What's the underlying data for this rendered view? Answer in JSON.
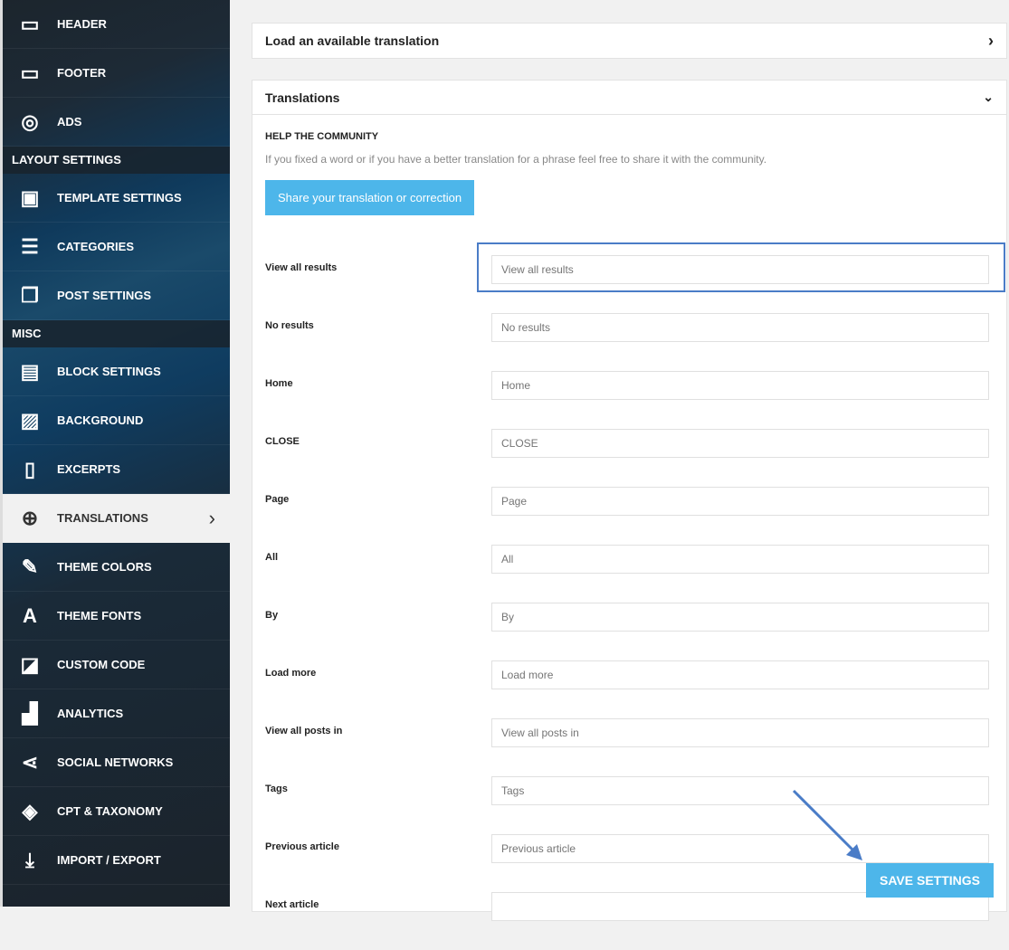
{
  "sidebar": {
    "items": [
      {
        "label": "HEADER",
        "icon": "header-icon",
        "glyph": "▭"
      },
      {
        "label": "FOOTER",
        "icon": "footer-icon",
        "glyph": "▭"
      },
      {
        "label": "ADS",
        "icon": "target-icon",
        "glyph": "◎"
      }
    ],
    "section_layout": "LAYOUT SETTINGS",
    "layout_items": [
      {
        "label": "TEMPLATE SETTINGS",
        "icon": "template-icon",
        "glyph": "▣"
      },
      {
        "label": "CATEGORIES",
        "icon": "list-icon",
        "glyph": "☰"
      },
      {
        "label": "POST SETTINGS",
        "icon": "post-icon",
        "glyph": "❐"
      }
    ],
    "section_misc": "MISC",
    "misc_items": [
      {
        "label": "BLOCK SETTINGS",
        "icon": "block-icon",
        "glyph": "▤"
      },
      {
        "label": "BACKGROUND",
        "icon": "image-icon",
        "glyph": "▨"
      },
      {
        "label": "EXCERPTS",
        "icon": "document-icon",
        "glyph": "▯"
      },
      {
        "label": "TRANSLATIONS",
        "icon": "globe-icon",
        "glyph": "⊕"
      },
      {
        "label": "THEME COLORS",
        "icon": "brush-icon",
        "glyph": "✎"
      },
      {
        "label": "THEME FONTS",
        "icon": "font-icon",
        "glyph": "A"
      },
      {
        "label": "CUSTOM CODE",
        "icon": "code-icon",
        "glyph": "◪"
      },
      {
        "label": "ANALYTICS",
        "icon": "chart-icon",
        "glyph": "▟"
      },
      {
        "label": "SOCIAL NETWORKS",
        "icon": "share-icon",
        "glyph": "⋖"
      },
      {
        "label": "CPT & TAXONOMY",
        "icon": "cube-icon",
        "glyph": "◈"
      },
      {
        "label": "IMPORT / EXPORT",
        "icon": "download-icon",
        "glyph": "⤓"
      }
    ]
  },
  "load_panel": {
    "title": "Load an available translation"
  },
  "translations": {
    "title": "Translations",
    "help_title": "HELP THE COMMUNITY",
    "help_text": "If you fixed a word or if you have a better translation for a phrase feel free to share it with the community.",
    "share_button": "Share your translation or correction",
    "fields": [
      {
        "label": "View all results",
        "placeholder": "View all results"
      },
      {
        "label": "No results",
        "placeholder": "No results"
      },
      {
        "label": "Home",
        "placeholder": "Home"
      },
      {
        "label": "CLOSE",
        "placeholder": "CLOSE"
      },
      {
        "label": "Page",
        "placeholder": "Page"
      },
      {
        "label": "All",
        "placeholder": "All"
      },
      {
        "label": "By",
        "placeholder": "By"
      },
      {
        "label": "Load more",
        "placeholder": "Load more"
      },
      {
        "label": "View all posts in",
        "placeholder": "View all posts in"
      },
      {
        "label": "Tags",
        "placeholder": "Tags"
      },
      {
        "label": "Previous article",
        "placeholder": "Previous article"
      },
      {
        "label": "Next article",
        "placeholder": ""
      }
    ]
  },
  "save_button": "SAVE SETTINGS"
}
